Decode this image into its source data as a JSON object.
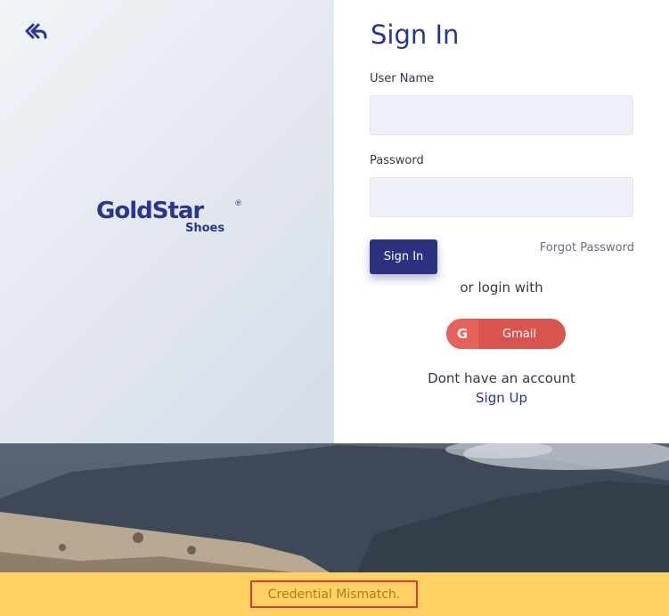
{
  "brand": {
    "name": "GoldStar",
    "registered_mark": "®",
    "subtitle": "Shoes"
  },
  "back_button": {
    "icon": "reply-all-icon"
  },
  "form": {
    "title": "Sign In",
    "username_label": "User Name",
    "username_value": "",
    "password_label": "Password",
    "password_value": "",
    "signin_button": "Sign In",
    "forgot_password": "Forgot Password",
    "alt_login_text": "or login with",
    "gmail_icon_letter": "G",
    "gmail_button": "Gmail",
    "no_account_text": "Dont have an account",
    "signup_link": "Sign Up"
  },
  "alert": {
    "message": "Credential Mismatch."
  },
  "colors": {
    "brand_blue": "#283593",
    "button_blue": "#2b3380",
    "gmail_red": "#d9534f",
    "alert_yellow": "#ffd263",
    "alert_border": "#e53935"
  }
}
